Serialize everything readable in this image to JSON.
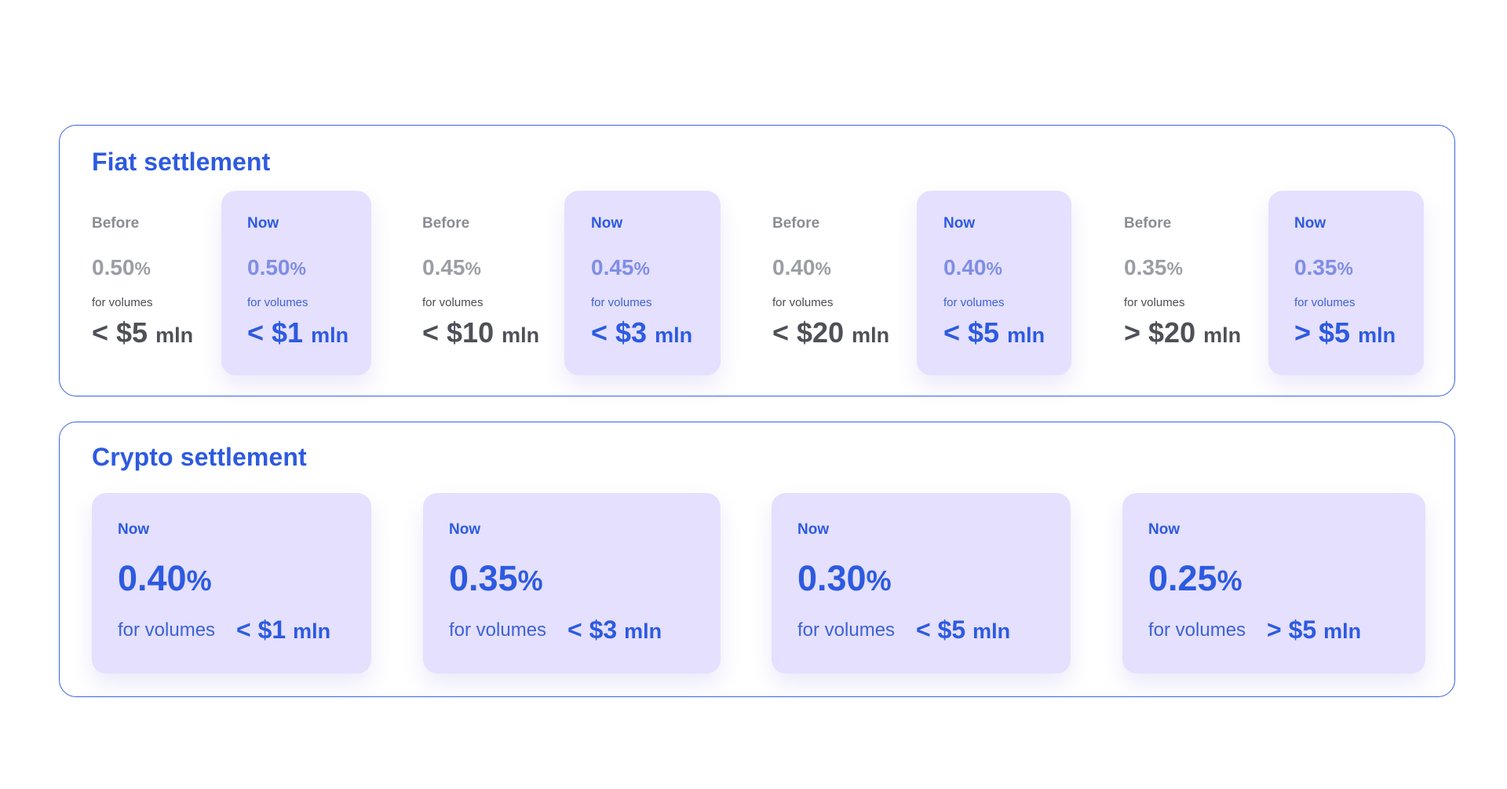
{
  "colors": {
    "accent": "#2d5ae0",
    "border": "#3b63e0",
    "card_bg": "#e4e0fd",
    "muted_text": "#8a8d93",
    "dark_text": "#4e5157"
  },
  "fiat": {
    "title": "Fiat settlement",
    "caption": "for volumes",
    "cells": [
      {
        "kind": "before",
        "label": "Before",
        "rate": "0.50",
        "pct": "%",
        "amount": "< $5",
        "unit": "mln"
      },
      {
        "kind": "now",
        "label": "Now",
        "rate": "0.50",
        "pct": "%",
        "amount": "< $1",
        "unit": "mln"
      },
      {
        "kind": "before",
        "label": "Before",
        "rate": "0.45",
        "pct": "%",
        "amount": "< $10",
        "unit": "mln"
      },
      {
        "kind": "now",
        "label": "Now",
        "rate": "0.45",
        "pct": "%",
        "amount": "< $3",
        "unit": "mln"
      },
      {
        "kind": "before",
        "label": "Before",
        "rate": "0.40",
        "pct": "%",
        "amount": "< $20",
        "unit": "mln"
      },
      {
        "kind": "now",
        "label": "Now",
        "rate": "0.40",
        "pct": "%",
        "amount": "< $5",
        "unit": "mln"
      },
      {
        "kind": "before",
        "label": "Before",
        "rate": "0.35",
        "pct": "%",
        "amount": "> $20",
        "unit": "mln"
      },
      {
        "kind": "now",
        "label": "Now",
        "rate": "0.35",
        "pct": "%",
        "amount": "> $5",
        "unit": "mln"
      }
    ]
  },
  "crypto": {
    "title": "Crypto settlement",
    "caption": "for volumes",
    "cards": [
      {
        "label": "Now",
        "rate": "0.40",
        "pct": "%",
        "amount": "< $1",
        "unit": "mln"
      },
      {
        "label": "Now",
        "rate": "0.35",
        "pct": "%",
        "amount": "< $3",
        "unit": "mln"
      },
      {
        "label": "Now",
        "rate": "0.30",
        "pct": "%",
        "amount": "< $5",
        "unit": "mln"
      },
      {
        "label": "Now",
        "rate": "0.25",
        "pct": "%",
        "amount": "> $5",
        "unit": "mln"
      }
    ]
  }
}
